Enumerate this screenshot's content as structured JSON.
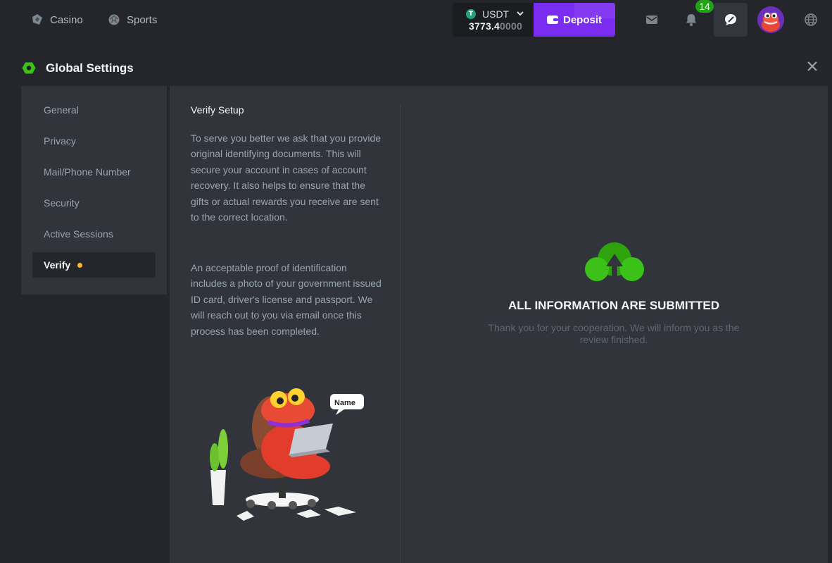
{
  "nav": {
    "casino_label": "Casino",
    "sports_label": "Sports",
    "casino_icon": "casino-icon",
    "sports_icon": "sports-ball-icon"
  },
  "wallet": {
    "currency": "USDT",
    "coin_glyph": "T",
    "balance_main": "3773.4",
    "balance_dim": "0000",
    "deposit_label": "Deposit"
  },
  "header": {
    "notification_count": "14",
    "icons": [
      "mail-icon",
      "bell-icon",
      "chat-icon",
      "avatar",
      "globe-icon"
    ]
  },
  "settings": {
    "title": "Global Settings",
    "menu": [
      {
        "label": "General"
      },
      {
        "label": "Privacy"
      },
      {
        "label": "Mail/Phone Number"
      },
      {
        "label": "Security"
      },
      {
        "label": "Active Sessions"
      },
      {
        "label": "Verify",
        "active": true,
        "status_dot": true
      }
    ]
  },
  "verify": {
    "title": "Verify Setup",
    "paragraph1": "To serve you better we ask that you provide original identifying documents. This will secure your account in cases of account recovery. It also helps to ensure that the gifts or actual rewards you receive are sent to the correct location.",
    "paragraph2": "An acceptable proof of identification includes a photo of your government issued ID card, driver's license and passport. We will reach out to you via email once this process has been completed.",
    "illustration_bubble": "Name",
    "status_title": "ALL INFORMATION ARE SUBMITTED",
    "status_message": "Thank you for your cooperation. We will inform you as the review finished."
  },
  "colors": {
    "accent_green": "#3bc117",
    "deposit_purple": "#7a2cf0",
    "badge_green": "#22a316",
    "status_dot": "#ffb82e"
  }
}
